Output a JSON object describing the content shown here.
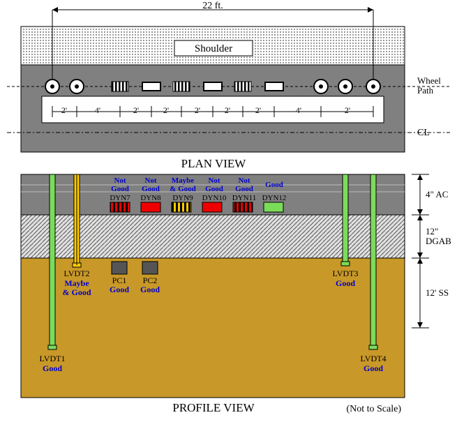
{
  "title_plan": "PLAN VIEW",
  "title_profile": "PROFILE VIEW",
  "not_to_scale": "(Not to Scale)",
  "shoulder": "Shoulder",
  "wheel_path": "Wheel Path",
  "cl": "CL",
  "total_width": "22 ft.",
  "spacings": [
    "2'",
    "4'",
    "2'",
    "2'",
    "2'",
    "2'",
    "2'",
    "4'",
    "2'"
  ],
  "layers": {
    "ac": "4\" AC",
    "dgab": "12\" DGAB",
    "ss": "12' SS"
  },
  "lvdt": {
    "lvdt1": {
      "label": "LVDT1",
      "status": "Good"
    },
    "lvdt2": {
      "label": "LVDT2",
      "status": "Maybe",
      "status2": "& Good"
    },
    "lvdt3": {
      "label": "LVDT3",
      "status": "Good"
    },
    "lvdt4": {
      "label": "LVDT4",
      "status": "Good"
    }
  },
  "pc": {
    "pc1": {
      "label": "PC1",
      "status": "Good"
    },
    "pc2": {
      "label": "PC2",
      "status": "Good"
    }
  },
  "dyn": {
    "d7": {
      "label": "DYN7",
      "s1": "Not",
      "s2": "Good"
    },
    "d8": {
      "label": "DYN8",
      "s1": "Not",
      "s2": "Good"
    },
    "d9": {
      "label": "DYN9",
      "s1": "Maybe",
      "s2": "& Good"
    },
    "d10": {
      "label": "DYN10",
      "s1": "Not",
      "s2": "Good"
    },
    "d11": {
      "label": "DYN11",
      "s1": "Not",
      "s2": "Good"
    },
    "d12": {
      "label": "DYN12",
      "s1": "Good",
      "s2": ""
    }
  }
}
